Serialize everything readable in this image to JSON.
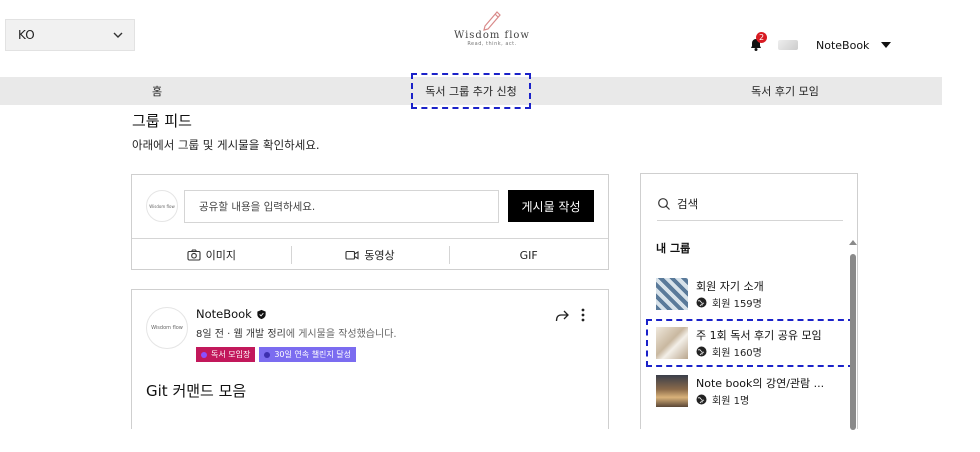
{
  "header": {
    "language": "KO",
    "logo_title": "Wisdom flow",
    "logo_subtitle": "Read, think, act.",
    "notification_count": "2",
    "username": "NoteBook"
  },
  "nav": {
    "items": [
      {
        "label": "홈"
      },
      {
        "label": "독서 그룹 추가 신청"
      },
      {
        "label": "독서 후기 모임"
      }
    ]
  },
  "feed": {
    "title": "그룹 피드",
    "description": "아래에서 그룹 및 게시물을 확인하세요."
  },
  "composer": {
    "avatar_text": "Wisdom flow",
    "placeholder": "공유할 내용을 입력하세요.",
    "post_button": "게시물 작성",
    "media": {
      "image": "이미지",
      "video": "동영상",
      "gif": "GIF"
    }
  },
  "post": {
    "avatar_text": "Wisdom flow",
    "author": "NoteBook",
    "meta_time": "8일 전 · 웹 개발 정리",
    "meta_action": "에 게시물을 작성했습니다.",
    "tags": [
      "독서 모임장",
      "30일 연속 챌린지 달성"
    ],
    "title": "Git 커맨드 모음"
  },
  "sidebar": {
    "search_label": "검색",
    "my_groups_heading": "내 그룹",
    "groups": [
      {
        "name": "회원 자기 소개",
        "members": "회원 159명"
      },
      {
        "name": "주 1회 독서 후기 공유 모임",
        "members": "회원 160명"
      },
      {
        "name": "Note book의 강연/관람 ...",
        "members": "회원 1명"
      }
    ]
  },
  "colors": {
    "highlight_border": "#1b22c9",
    "badge_red": "#d81b22",
    "tag_red": "#c2185b",
    "tag_purple": "#7b6cf0",
    "nav_bg": "#e9e9e9"
  }
}
